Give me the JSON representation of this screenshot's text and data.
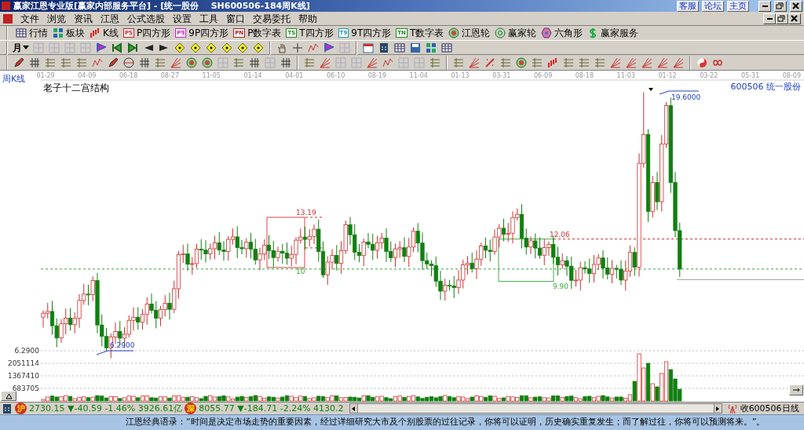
{
  "window": {
    "title": "赢家江恩专业版[赢家内部服务平台] - [统一股份    SH600506-184周K线]",
    "links": [
      "客服",
      "论坛",
      "主页"
    ]
  },
  "menu": {
    "items": [
      "文件",
      "浏览",
      "资讯",
      "江恩",
      "公式选股",
      "设置",
      "工具",
      "窗口",
      "交易委托",
      "帮助"
    ]
  },
  "toolbar": {
    "buttons": [
      {
        "kind": "icon",
        "label": "行情"
      },
      {
        "kind": "icon",
        "label": "板块"
      },
      {
        "kind": "icon",
        "label": "K线"
      },
      {
        "kind": "badge",
        "badge": "PS",
        "color": "#cc2222",
        "label": "P四方形"
      },
      {
        "kind": "badge",
        "badge": "P9",
        "color": "#cc22cc",
        "label": "9P四方形"
      },
      {
        "kind": "badge",
        "badge": "PN",
        "color": "#aa2222",
        "label": "P数字表"
      },
      {
        "kind": "badge",
        "badge": "TS",
        "color": "#228822",
        "label": "T四方形"
      },
      {
        "kind": "badge",
        "badge": "T9",
        "color": "#2299aa",
        "label": "9T四方形"
      },
      {
        "kind": "badge",
        "badge": "TN",
        "color": "#228822",
        "label": "T数字表"
      },
      {
        "kind": "icon",
        "label": "江恩轮"
      },
      {
        "kind": "icon",
        "label": "赢家轮"
      },
      {
        "kind": "icon",
        "label": "六角形"
      },
      {
        "kind": "icon",
        "label": "赢家服务"
      }
    ]
  },
  "period_selector": {
    "value": "月"
  },
  "chart": {
    "panel_label": "周K线",
    "title": "老子十二宫结构",
    "stock": "600506 统一股份",
    "dates": [
      "01-29",
      "04-09",
      "06-18",
      "08-27",
      "11-05",
      "01-14",
      "04-01",
      "06-10",
      "08-19",
      "11-04",
      "01-13",
      "03-31",
      "06-09",
      "08-18",
      "11-03",
      "01-12",
      "03-22",
      "05-31",
      "08-09"
    ],
    "price_tick": "6.2900",
    "high_label": "19.6000",
    "low_label": "6.2900",
    "box_labels": [
      "13.19",
      "10",
      "12.06",
      "9.90"
    ],
    "volume_ticks": [
      "2051114",
      "1367410",
      "683705"
    ]
  },
  "status_bar": {
    "indices": [
      {
        "badge": "沪",
        "text": "2730.15 ▼-40.59 -1.46% 3926.61亿"
      },
      {
        "badge": "深",
        "text": "8055.77 ▼-184.71 -2.24% 4130.2"
      }
    ],
    "data_source": "收600506日线"
  },
  "quote_bar": {
    "text": "江恩经典语录：“时间是决定市场走势的重要因素，经过详细研究大市及个别股票的过往记录，你将可以证明，历史确实重复发生；而了解过往，你将可以预测将来。”。"
  }
}
